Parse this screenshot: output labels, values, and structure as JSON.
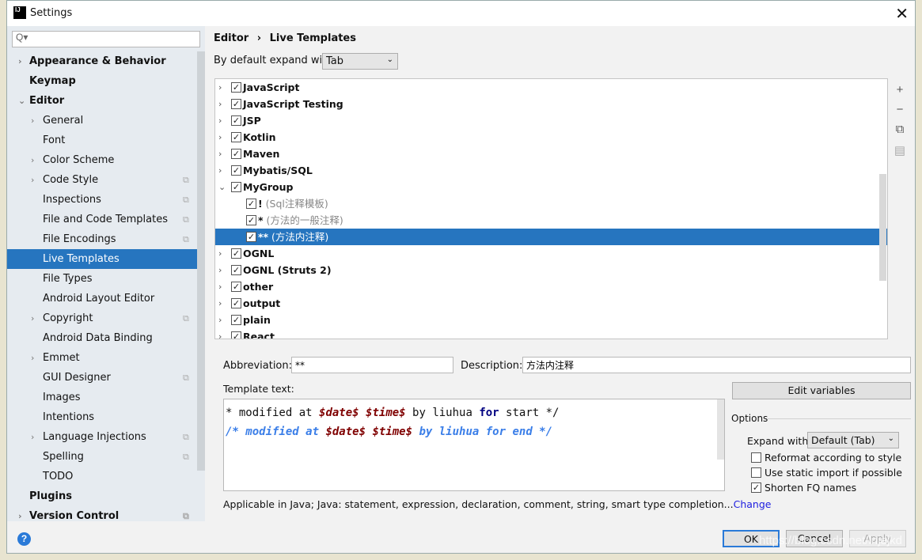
{
  "window": {
    "title": "Settings",
    "logo": "IJ"
  },
  "sidebar": {
    "search_placeholder": "Q▾",
    "items": [
      {
        "label": "Appearance & Behavior",
        "level": 0,
        "arrow": "›",
        "bold": true
      },
      {
        "label": "Keymap",
        "level": 0,
        "arrow": "",
        "bold": true
      },
      {
        "label": "Editor",
        "level": 0,
        "arrow": "⌄",
        "bold": true
      },
      {
        "label": "General",
        "level": 1,
        "arrow": "›"
      },
      {
        "label": "Font",
        "level": 1,
        "arrow": ""
      },
      {
        "label": "Color Scheme",
        "level": 1,
        "arrow": "›"
      },
      {
        "label": "Code Style",
        "level": 1,
        "arrow": "›",
        "copy": true
      },
      {
        "label": "Inspections",
        "level": 1,
        "arrow": "",
        "copy": true
      },
      {
        "label": "File and Code Templates",
        "level": 1,
        "arrow": "",
        "copy": true
      },
      {
        "label": "File Encodings",
        "level": 1,
        "arrow": "",
        "copy": true
      },
      {
        "label": "Live Templates",
        "level": 1,
        "arrow": "",
        "selected": true
      },
      {
        "label": "File Types",
        "level": 1,
        "arrow": ""
      },
      {
        "label": "Android Layout Editor",
        "level": 1,
        "arrow": ""
      },
      {
        "label": "Copyright",
        "level": 1,
        "arrow": "›",
        "copy": true
      },
      {
        "label": "Android Data Binding",
        "level": 1,
        "arrow": ""
      },
      {
        "label": "Emmet",
        "level": 1,
        "arrow": "›"
      },
      {
        "label": "GUI Designer",
        "level": 1,
        "arrow": "",
        "copy": true
      },
      {
        "label": "Images",
        "level": 1,
        "arrow": ""
      },
      {
        "label": "Intentions",
        "level": 1,
        "arrow": ""
      },
      {
        "label": "Language Injections",
        "level": 1,
        "arrow": "›",
        "copy": true
      },
      {
        "label": "Spelling",
        "level": 1,
        "arrow": "",
        "copy": true
      },
      {
        "label": "TODO",
        "level": 1,
        "arrow": ""
      },
      {
        "label": "Plugins",
        "level": 0,
        "arrow": "",
        "bold": true
      },
      {
        "label": "Version Control",
        "level": 0,
        "arrow": "›",
        "bold": true,
        "copy": true
      }
    ]
  },
  "breadcrumb": {
    "parent": "Editor",
    "sep": "›",
    "current": "Live Templates"
  },
  "expand_default": {
    "label": "By default expand with",
    "value": "Tab"
  },
  "templates": [
    {
      "label": "JavaScript",
      "arrow": "›",
      "group": true,
      "checked": true
    },
    {
      "label": "JavaScript Testing",
      "arrow": "›",
      "group": true,
      "checked": true
    },
    {
      "label": "JSP",
      "arrow": "›",
      "group": true,
      "checked": true
    },
    {
      "label": "Kotlin",
      "arrow": "›",
      "group": true,
      "checked": true
    },
    {
      "label": "Maven",
      "arrow": "›",
      "group": true,
      "checked": true
    },
    {
      "label": "Mybatis/SQL",
      "arrow": "›",
      "group": true,
      "checked": true
    },
    {
      "label": "MyGroup",
      "arrow": "⌄",
      "group": true,
      "checked": true
    },
    {
      "label": "!",
      "desc": " (Sql注释模板)",
      "group": false,
      "checked": true
    },
    {
      "label": "*",
      "desc": " (方法的一般注释)",
      "group": false,
      "checked": true
    },
    {
      "label": "**",
      "desc": " (方法内注释)",
      "group": false,
      "checked": true,
      "selected": true
    },
    {
      "label": "OGNL",
      "arrow": "›",
      "group": true,
      "checked": true
    },
    {
      "label": "OGNL (Struts 2)",
      "arrow": "›",
      "group": true,
      "checked": true
    },
    {
      "label": "other",
      "arrow": "›",
      "group": true,
      "checked": true
    },
    {
      "label": "output",
      "arrow": "›",
      "group": true,
      "checked": true
    },
    {
      "label": "plain",
      "arrow": "›",
      "group": true,
      "checked": true
    },
    {
      "label": "React",
      "arrow": "›",
      "group": true,
      "checked": true
    }
  ],
  "toolbar": {
    "add": "+",
    "remove": "−",
    "copy": "⧉",
    "edit": "▤"
  },
  "editor": {
    "abbreviation_label": "Abbreviation:",
    "abbreviation": "**",
    "description_label": "Description:",
    "description": "方法内注释",
    "template_label": "Template text:",
    "line1": {
      "a": "* modified at ",
      "v1": "$date$",
      "b": " ",
      "v2": "$time$",
      "c": " by liuhua ",
      "kw": "for",
      "d": " start */"
    },
    "line2": {
      "a": "/* modified at ",
      "v1": "$date$",
      "b": " ",
      "v2": "$time$",
      "c": " by liuhua for end */"
    },
    "edit_variables": "Edit variables",
    "options_label": "Options",
    "expand_with_label": "Expand with",
    "expand_with_value": "Default (Tab)",
    "options": [
      {
        "label": "Reformat according to style",
        "checked": false
      },
      {
        "label": "Use static import if possible",
        "checked": false
      },
      {
        "label": "Shorten FQ names",
        "checked": true
      }
    ],
    "applicable": "Applicable in Java; Java: statement, expression, declaration, comment, string, smart type completion...",
    "change_link": "Change"
  },
  "buttons": {
    "ok": "OK",
    "cancel": "Cancel",
    "apply": "Apply",
    "help": "?"
  },
  "watermark": "https://blog.csdn.net/lnjejkd",
  "colors": {
    "selection": "#2675bf",
    "variable": "#7f0000",
    "keyword": "#000080",
    "comment": "#3a7ee8",
    "link": "#2020e0"
  }
}
